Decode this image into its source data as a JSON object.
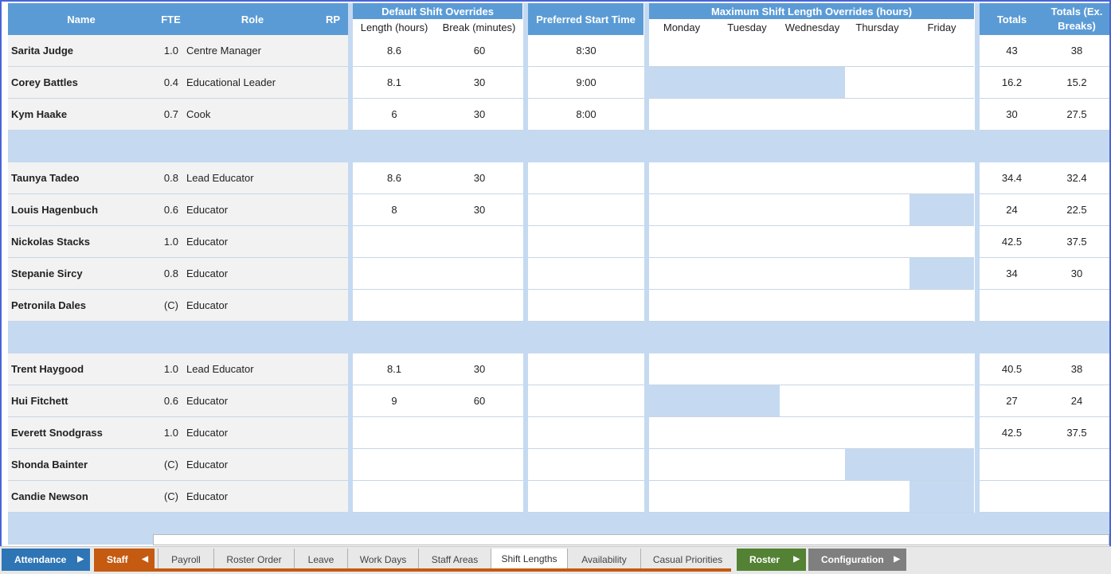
{
  "colors": {
    "header": "#5b9bd5",
    "light_blue": "#c5d9f1",
    "attendance": "#2e75b6",
    "staff": "#c55a11",
    "roster": "#548235",
    "configuration": "#7f7f7f"
  },
  "header": {
    "name": "Name",
    "fte": "FTE",
    "role": "Role",
    "rp": "RP",
    "default_shift_overrides": "Default Shift Overrides",
    "length_hours": "Length (hours)",
    "break_minutes": "Break (minutes)",
    "preferred_start_time": "Preferred Start Time",
    "max_shift_length_overrides": "Maximum Shift Length Overrides (hours)",
    "days": [
      "Monday",
      "Tuesday",
      "Wednesday",
      "Thursday",
      "Friday"
    ],
    "totals": "Totals",
    "totals_ex_breaks": "Totals (Ex. Breaks)"
  },
  "rows": [
    {
      "name": "Sarita Judge",
      "fte": "1.0",
      "role": "Centre Manager",
      "length": "8.6",
      "break": "60",
      "start": "8:30",
      "blue_days": [],
      "totals": "43",
      "totals_ex": "38"
    },
    {
      "name": "Corey Battles",
      "fte": "0.4",
      "role": "Educational Leader",
      "length": "8.1",
      "break": "30",
      "start": "9:00",
      "blue_days": [
        0,
        1,
        2
      ],
      "totals": "16.2",
      "totals_ex": "15.2"
    },
    {
      "name": "Kym Haake",
      "fte": "0.7",
      "role": "Cook",
      "length": "6",
      "break": "30",
      "start": "8:00",
      "blue_days": [],
      "totals": "30",
      "totals_ex": "27.5"
    },
    {
      "separator": true
    },
    {
      "name": "Taunya Tadeo",
      "fte": "0.8",
      "role": "Lead Educator",
      "length": "8.6",
      "break": "30",
      "start": "",
      "blue_days": [],
      "totals": "34.4",
      "totals_ex": "32.4"
    },
    {
      "name": "Louis Hagenbuch",
      "fte": "0.6",
      "role": "Educator",
      "length": "8",
      "break": "30",
      "start": "",
      "blue_days": [
        4
      ],
      "totals": "24",
      "totals_ex": "22.5"
    },
    {
      "name": "Nickolas Stacks",
      "fte": "1.0",
      "role": "Educator",
      "length": "",
      "break": "",
      "start": "",
      "blue_days": [],
      "totals": "42.5",
      "totals_ex": "37.5"
    },
    {
      "name": "Stepanie Sircy",
      "fte": "0.8",
      "role": "Educator",
      "length": "",
      "break": "",
      "start": "",
      "blue_days": [
        4
      ],
      "totals": "34",
      "totals_ex": "30"
    },
    {
      "name": "Petronila Dales",
      "fte": "(C)",
      "role": "Educator",
      "length": "",
      "break": "",
      "start": "",
      "blue_days": [],
      "totals": "",
      "totals_ex": ""
    },
    {
      "separator": true
    },
    {
      "name": "Trent Haygood",
      "fte": "1.0",
      "role": "Lead Educator",
      "length": "8.1",
      "break": "30",
      "start": "",
      "blue_days": [],
      "totals": "40.5",
      "totals_ex": "38"
    },
    {
      "name": "Hui Fitchett",
      "fte": "0.6",
      "role": "Educator",
      "length": "9",
      "break": "60",
      "start": "",
      "blue_days": [
        0,
        1
      ],
      "totals": "27",
      "totals_ex": "24"
    },
    {
      "name": "Everett Snodgrass",
      "fte": "1.0",
      "role": "Educator",
      "length": "",
      "break": "",
      "start": "",
      "blue_days": [],
      "totals": "42.5",
      "totals_ex": "37.5"
    },
    {
      "name": "Shonda Bainter",
      "fte": "(C)",
      "role": "Educator",
      "length": "",
      "break": "",
      "start": "",
      "blue_days": [
        3,
        4
      ],
      "totals": "",
      "totals_ex": ""
    },
    {
      "name": "Candie Newson",
      "fte": "(C)",
      "role": "Educator",
      "length": "",
      "break": "",
      "start": "",
      "blue_days": [
        4
      ],
      "totals": "",
      "totals_ex": ""
    },
    {
      "separator": true
    }
  ],
  "tabs": {
    "attendance": "Attendance",
    "staff": "Staff",
    "payroll": "Payroll",
    "roster_order": "Roster Order",
    "leave": "Leave",
    "work_days": "Work Days",
    "staff_areas": "Staff Areas",
    "shift_lengths": "Shift Lengths",
    "availability": "Availability",
    "casual_priorities": "Casual Priorities",
    "roster": "Roster",
    "configuration": "Configuration",
    "active": "Shift Lengths"
  }
}
